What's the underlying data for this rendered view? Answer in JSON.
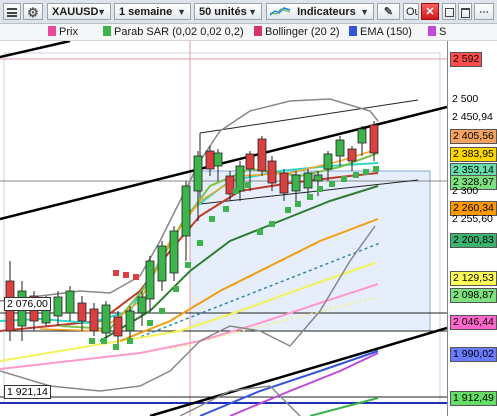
{
  "toolbar": {
    "symbol": "XAUUSD",
    "timeframe": "1 semaine",
    "units": "50 unités",
    "indicators": "Indicateurs",
    "tools": "Ou"
  },
  "legend": [
    {
      "label": "Prix",
      "color": "#e8499b"
    },
    {
      "label": "Parab SAR (0,02 0,02 0,2)",
      "color": "#3cb44b"
    },
    {
      "label": "Bollinger (20 2)",
      "color": "#d6336c"
    },
    {
      "label": "EMA (150)",
      "color": "#3455db"
    },
    {
      "label": "S",
      "color": "#c04bd8"
    }
  ],
  "price_axis": [
    {
      "text": "2 592",
      "bg": "#ff4d4d",
      "fg": "#000000",
      "boxed": true
    },
    {
      "text": "2 500",
      "bg": "#ffffff",
      "fg": "#000000",
      "boxed": false
    },
    {
      "text": "2 450,94",
      "bg": "#ffffff",
      "fg": "#000000",
      "boxed": false
    },
    {
      "text": "2 405,56",
      "bg": "#f4a460",
      "fg": "#000000",
      "boxed": true
    },
    {
      "text": "2 383,95",
      "bg": "#ffd700",
      "fg": "#000000",
      "boxed": true
    },
    {
      "text": "2 353,14",
      "bg": "#66ddaa",
      "fg": "#000000",
      "boxed": true
    },
    {
      "text": "2 328,97",
      "bg": "#7ee07e",
      "fg": "#000000",
      "boxed": true
    },
    {
      "text": "2 300",
      "bg": "#ffffff",
      "fg": "#000000",
      "boxed": false
    },
    {
      "text": "2 260,34",
      "bg": "#ff9900",
      "fg": "#000000",
      "boxed": true
    },
    {
      "text": "2 255,60",
      "bg": "#ffffff",
      "fg": "#000000",
      "boxed": false
    },
    {
      "text": "2 200,83",
      "bg": "#3cb371",
      "fg": "#000000",
      "boxed": true
    },
    {
      "text": "2 129,53",
      "bg": "#ffff55",
      "fg": "#000000",
      "boxed": true
    },
    {
      "text": "2 098,87",
      "bg": "#7ee07e",
      "fg": "#000000",
      "boxed": true
    },
    {
      "text": "2 046,44",
      "bg": "#ff66cc",
      "fg": "#000000",
      "boxed": true
    },
    {
      "text": "1 990,02",
      "bg": "#6a7cff",
      "fg": "#000000",
      "boxed": true
    },
    {
      "text": "1 912,49",
      "bg": "#66dd66",
      "fg": "#000000",
      "boxed": true
    }
  ],
  "labels": {
    "level_2076": "2 076,00",
    "level_1921": "1 921,14"
  }
}
